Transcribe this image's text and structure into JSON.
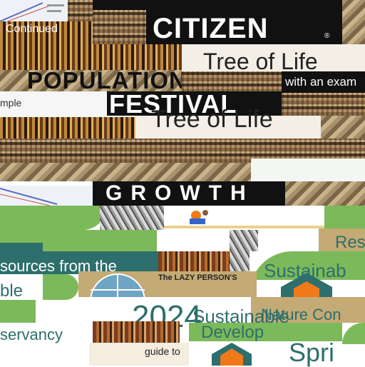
{
  "collage": {
    "continued": "Continued",
    "citizen": "CITIZEN",
    "registered_mark": "®",
    "tree_of_life_top": "Tree of Life",
    "with_an_example": "with an exam",
    "population": "POPULATION",
    "ample": "mple",
    "festival": "FESTIVAL",
    "tree_of_life_mid": "Tree of Life",
    "growth": "GROWTH",
    "resources_from_the": "sources from the",
    "res": "Res",
    "lazy_person": "The LAZY PERSON'S",
    "sustainable": "Sustainab",
    "ble": "ble",
    "nature_con": "Nature Con",
    "year": "2024",
    "sustainable_dev": "Sustainable",
    "development": "Develop",
    "conservancy": "servancy",
    "guide_to": "guide to",
    "spri": "Spri"
  },
  "colors": {
    "green": "#7cb95a",
    "teal": "#2d6f6c",
    "orange": "#f07a1a",
    "tan": "#c4aa74",
    "black": "#111111"
  },
  "icons": [
    "house-logo-icon",
    "globe-icon",
    "chart-thumbnail-icon"
  ]
}
